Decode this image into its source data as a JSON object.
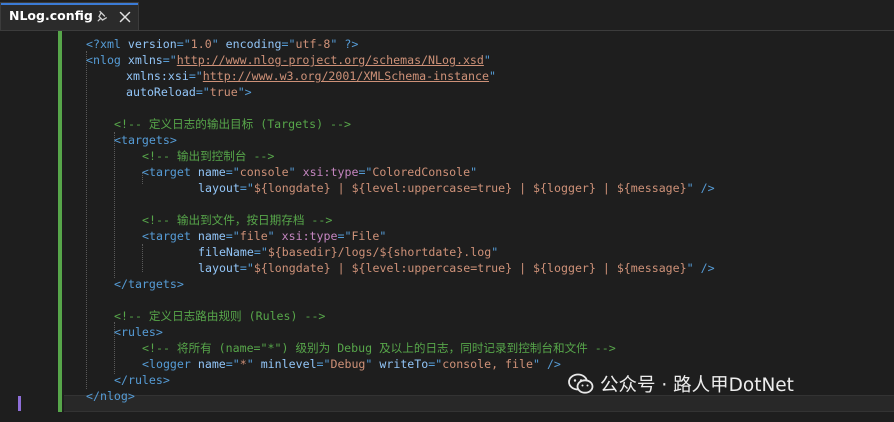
{
  "tab": {
    "title": "NLog.config",
    "pin_icon": "pin-icon",
    "close_icon": "close-icon"
  },
  "watermark": {
    "text": "公众号 · 路人甲DotNet",
    "icon": "wechat-icon"
  },
  "colors": {
    "tag": "#569cd6",
    "attribute": "#92c5f7",
    "value": "#ce9178",
    "comment": "#57a64a",
    "text": "#d4d4d4",
    "change_bar": "#57a64a",
    "tab_accent": "#3b7bd6"
  },
  "code": {
    "lines": [
      [
        "<?",
        "xml",
        " ",
        "version",
        "=\"",
        "1.0",
        "\" ",
        "encoding",
        "=\"",
        "utf-8",
        "\" ?>"
      ],
      [
        "<",
        "nlog",
        " ",
        "xmlns",
        "=\"",
        "http://www.nlog-project.org/schemas/NLog.xsd",
        "\""
      ],
      [
        "xmlns:xsi",
        "=\"",
        "http://www.w3.org/2001/XMLSchema-instance",
        "\""
      ],
      [
        "autoReload",
        "=\"",
        "true",
        "\">"
      ],
      [],
      [
        "<!-- 定义日志的输出目标 (Targets) -->"
      ],
      [
        "<",
        "targets",
        ">"
      ],
      [
        "<!-- 输出到控制台 -->"
      ],
      [
        "<",
        "target",
        " ",
        "name",
        "=\"",
        "console",
        "\" ",
        "xsi:type",
        "=\"",
        "ColoredConsole",
        "\""
      ],
      [
        "layout",
        "=\"",
        "${longdate} | ${level:uppercase=true} | ${logger} | ${message}",
        "\" />"
      ],
      [],
      [
        "<!-- 输出到文件，按日期存档 -->"
      ],
      [
        "<",
        "target",
        " ",
        "name",
        "=\"",
        "file",
        "\" ",
        "xsi:type",
        "=\"",
        "File",
        "\""
      ],
      [
        "fileName",
        "=\"",
        "${basedir}/logs/${shortdate}.log",
        "\""
      ],
      [
        "layout",
        "=\"",
        "${longdate} | ${level:uppercase=true} | ${logger} | ${message}",
        "\" />"
      ],
      [
        "</",
        "targets",
        ">"
      ],
      [],
      [
        "<!-- 定义日志路由规则 (Rules) -->"
      ],
      [
        "<",
        "rules",
        ">"
      ],
      [
        "<!-- 将所有 (name=\"*\") 级别为 Debug 及以上的日志，同时记录到控制台和文件 -->"
      ],
      [
        "<",
        "logger",
        " ",
        "name",
        "=\"",
        "*",
        "\" ",
        "minlevel",
        "=\"",
        "Debug",
        "\" ",
        "writeTo",
        "=\"",
        "console, file",
        "\" />"
      ],
      [
        "</",
        "rules",
        ">"
      ],
      [
        "</",
        "nlog",
        ">"
      ]
    ]
  }
}
